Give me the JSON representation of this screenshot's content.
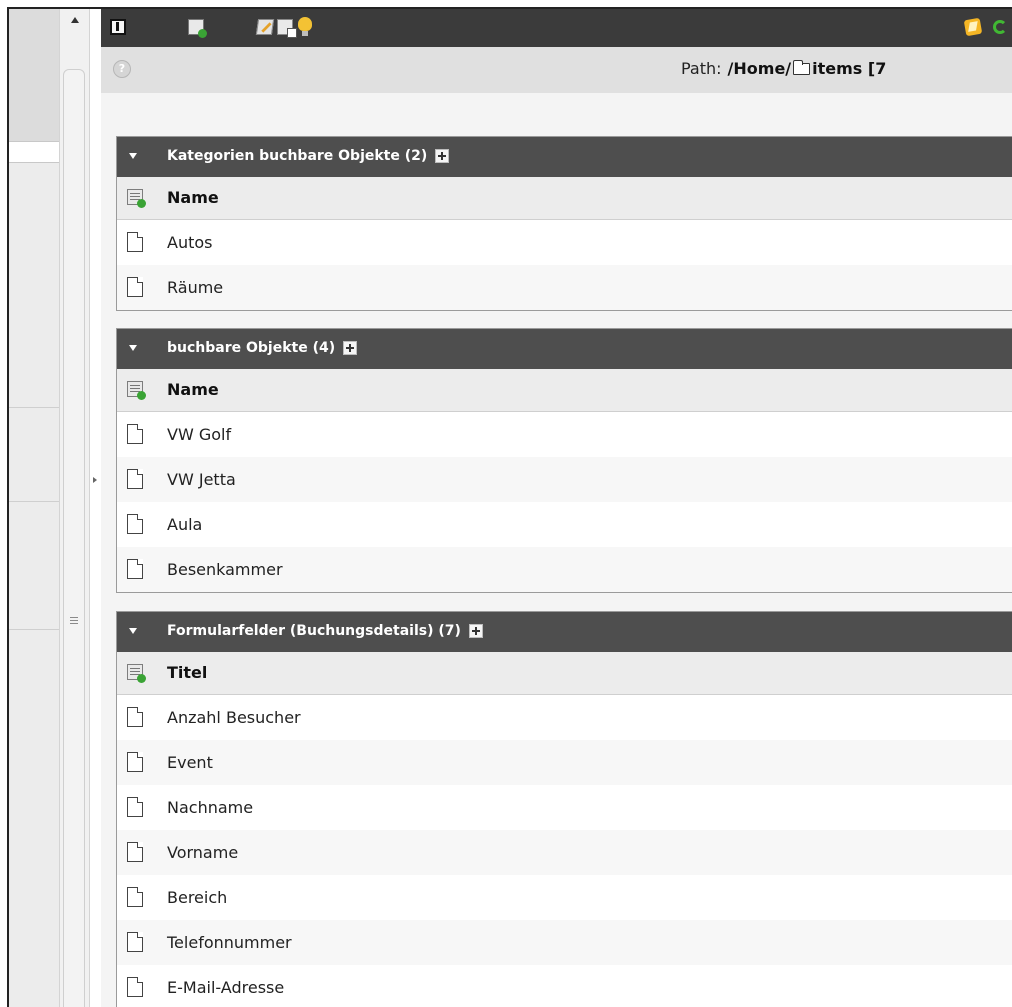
{
  "path": {
    "label": "Path:",
    "value_prefix": "/Home/",
    "folder_name": "items [7"
  },
  "toolbar": {
    "icons": [
      "go-up-icon",
      "new-record-icon",
      "edit-page-icon",
      "paste-icon",
      "tip-icon",
      "shortcut-icon",
      "reload-icon"
    ]
  },
  "panels": [
    {
      "title": "Kategorien buchbare Objekte (2)",
      "column": "Name",
      "rows": [
        "Autos",
        "Räume"
      ]
    },
    {
      "title": "buchbare Objekte (4)",
      "column": "Name",
      "rows": [
        "VW Golf",
        "VW Jetta",
        "Aula",
        "Besenkammer"
      ]
    },
    {
      "title": "Formularfelder (Buchungsdetails) (7)",
      "column": "Titel",
      "rows": [
        "Anzahl Besucher",
        "Event",
        "Nachname",
        "Vorname",
        "Bereich",
        "Telefonnummer",
        "E-Mail-Adresse"
      ]
    }
  ]
}
